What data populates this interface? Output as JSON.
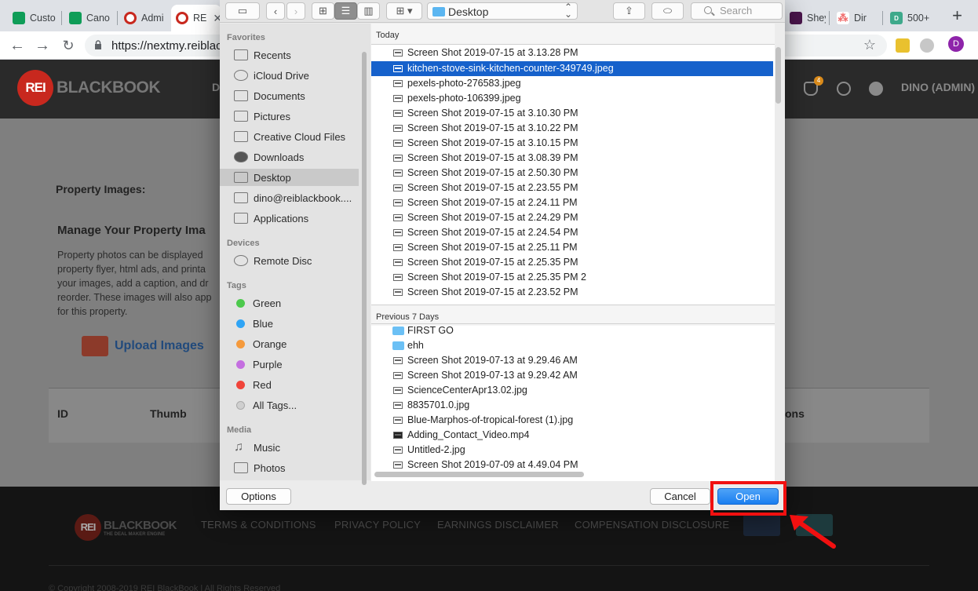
{
  "browser": {
    "tabs": [
      {
        "label": "Custo",
        "icon": "sheets-icon"
      },
      {
        "label": "Cano",
        "icon": "sheets-icon"
      },
      {
        "label": "Admi",
        "icon": "rei-icon"
      },
      {
        "label": "RE",
        "icon": "rei-icon",
        "active": true
      },
      {
        "label": "Shey",
        "icon": "slack-icon"
      },
      {
        "label": "Dir",
        "icon": "asana-icon"
      },
      {
        "label": "500+",
        "icon": "d-icon"
      }
    ],
    "url": "https://nextmy.reiblackbook",
    "avatar_letter": "D"
  },
  "site": {
    "logo_badge": "REI",
    "logo_word": "BLACKBOOK",
    "nav_first_letter": "D",
    "notification_count": "4",
    "user_label": "DINO (ADMIN)",
    "property_images_title": "Property Images:",
    "manage_title": "Manage Your Property Ima",
    "description": "Property photos can be displayed property flyer, html ads, and printa your images, add a caption, and dr reorder. These images will also app for this property.",
    "upload_label": "Upload Images",
    "table_headers": [
      "ID",
      "Thumb",
      "ons"
    ],
    "footer": {
      "tagline": "THE DEAL MAKER ENGINE",
      "links": [
        "TERMS & CONDITIONS",
        "PRIVACY POLICY",
        "EARNINGS DISCLAIMER",
        "COMPENSATION DISCLOSURE"
      ],
      "copyright": "© Copyright 2008-2019 REI BlackBook | All Rights Reserved"
    }
  },
  "dialog": {
    "location": "Desktop",
    "search_placeholder": "Search",
    "sidebar": {
      "favorites_label": "Favorites",
      "favorites": [
        "Recents",
        "iCloud Drive",
        "Documents",
        "Pictures",
        "Creative Cloud Files",
        "Downloads",
        "Desktop",
        "dino@reiblackbook....",
        "Applications"
      ],
      "selected": "Desktop",
      "devices_label": "Devices",
      "devices": [
        "Remote Disc"
      ],
      "tags_label": "Tags",
      "tags": [
        {
          "label": "Green",
          "color": "#4cc94c"
        },
        {
          "label": "Blue",
          "color": "#2fa4f5"
        },
        {
          "label": "Orange",
          "color": "#f59a3c"
        },
        {
          "label": "Purple",
          "color": "#c46fe0"
        },
        {
          "label": "Red",
          "color": "#f0443a"
        },
        {
          "label": "All Tags...",
          "color": "#cfcfcf"
        }
      ],
      "media_label": "Media",
      "media": [
        "Music",
        "Photos"
      ]
    },
    "today_label": "Today",
    "today_files": [
      "Screen Shot 2019-07-15 at 3.13.28 PM",
      "kitchen-stove-sink-kitchen-counter-349749.jpeg",
      "pexels-photo-276583.jpeg",
      "pexels-photo-106399.jpeg",
      "Screen Shot 2019-07-15 at 3.10.30 PM",
      "Screen Shot 2019-07-15 at 3.10.22 PM",
      "Screen Shot 2019-07-15 at 3.10.15 PM",
      "Screen Shot 2019-07-15 at 3.08.39 PM",
      "Screen Shot 2019-07-15 at 2.50.30 PM",
      "Screen Shot 2019-07-15 at 2.23.55 PM",
      "Screen Shot 2019-07-15 at 2.24.11 PM",
      "Screen Shot 2019-07-15 at 2.24.29 PM",
      "Screen Shot 2019-07-15 at 2.24.54 PM",
      "Screen Shot 2019-07-15 at 2.25.11 PM",
      "Screen Shot 2019-07-15 at 2.25.35 PM",
      "Screen Shot 2019-07-15 at 2.25.35 PM 2",
      "Screen Shot 2019-07-15 at 2.23.52 PM"
    ],
    "selected_file": "kitchen-stove-sink-kitchen-counter-349749.jpeg",
    "previous_label": "Previous 7 Days",
    "previous_files": [
      {
        "name": "FIRST GO",
        "kind": "folder"
      },
      {
        "name": "ehh",
        "kind": "folder"
      },
      {
        "name": "Screen Shot 2019-07-13 at 9.29.46 AM",
        "kind": "file"
      },
      {
        "name": "Screen Shot 2019-07-13 at 9.29.42 AM",
        "kind": "file"
      },
      {
        "name": "ScienceCenterApr13.02.jpg",
        "kind": "file"
      },
      {
        "name": "8835701.0.jpg",
        "kind": "file"
      },
      {
        "name": "Blue-Marphos-of-tropical-forest (1).jpg",
        "kind": "file"
      },
      {
        "name": "Adding_Contact_Video.mp4",
        "kind": "file"
      },
      {
        "name": "Untitled-2.jpg",
        "kind": "file"
      },
      {
        "name": "Screen Shot 2019-07-09 at 4.49.04 PM",
        "kind": "file"
      }
    ],
    "options_label": "Options",
    "cancel_label": "Cancel",
    "open_label": "Open"
  },
  "annotation": {
    "highlight_color": "#f11010"
  }
}
